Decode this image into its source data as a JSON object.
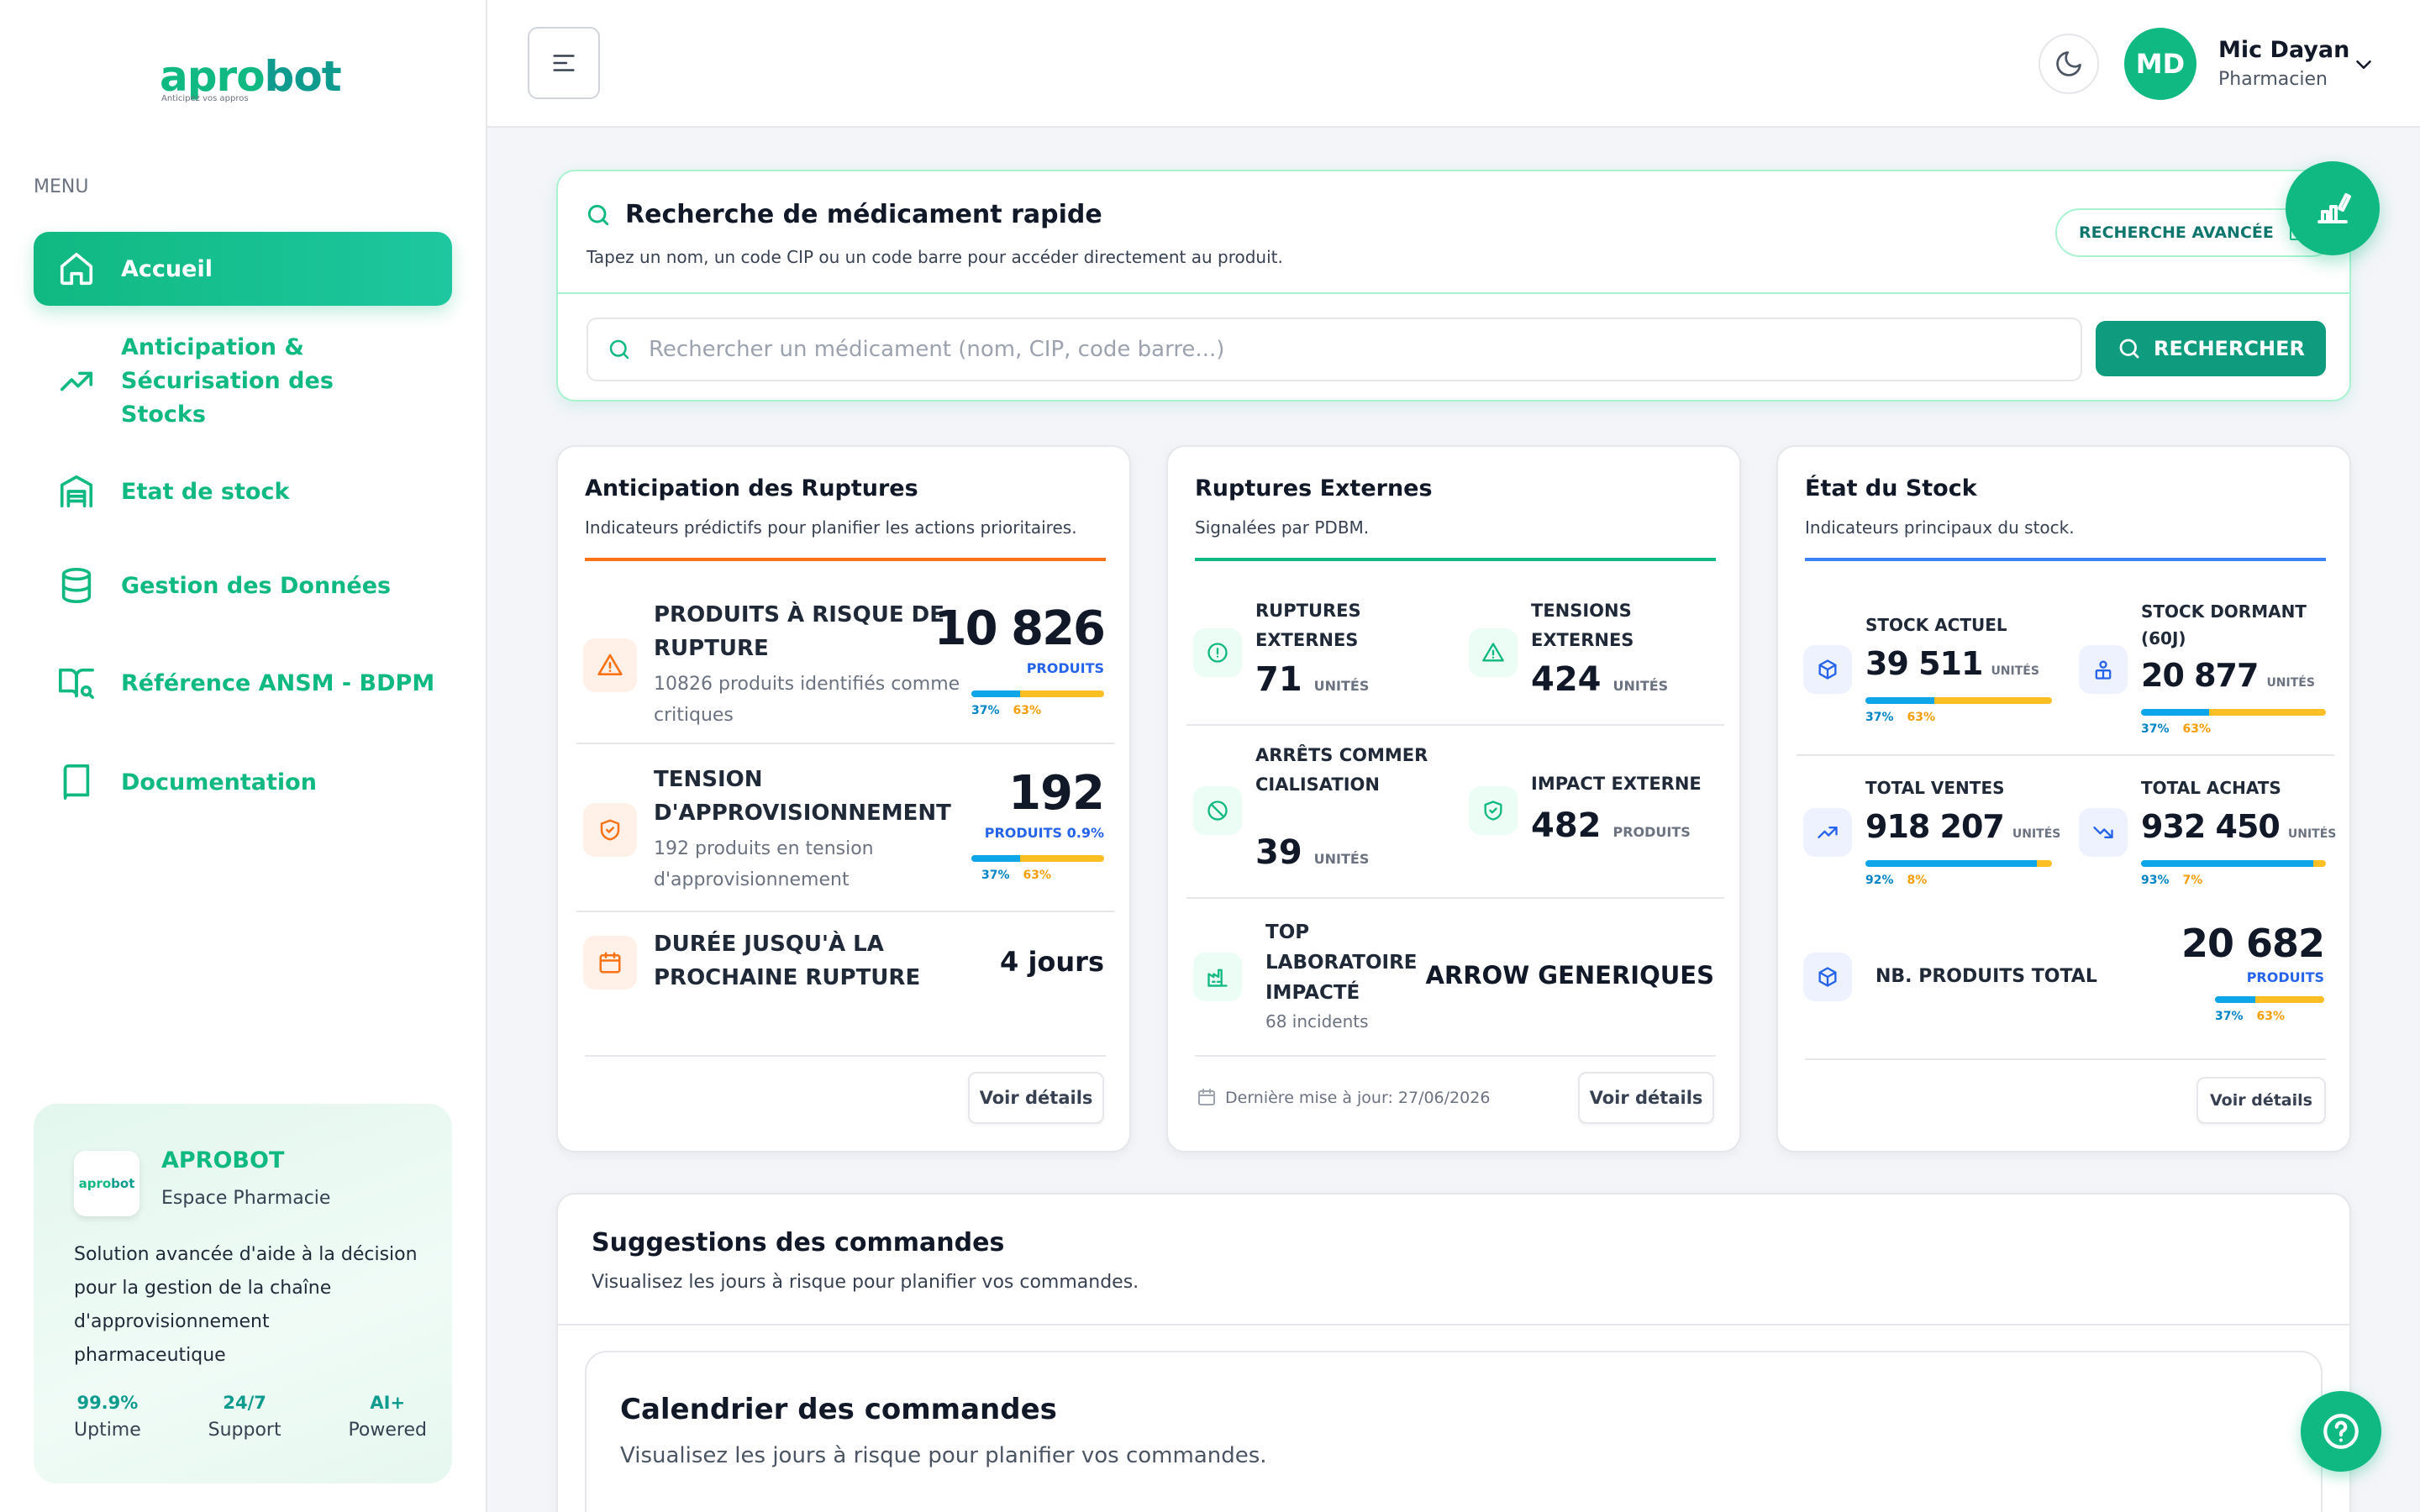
{
  "brand": {
    "logo_prefix": "apro",
    "logo_suffix": "bot",
    "tagline": "Anticipez vos appros"
  },
  "sidebar": {
    "menu_heading": "MENU",
    "items": [
      {
        "label": "Accueil",
        "icon": "home-icon"
      },
      {
        "label": "Anticipation & Sécurisation des Stocks",
        "icon": "trending-up-icon"
      },
      {
        "label": "Etat de stock",
        "icon": "warehouse-icon"
      },
      {
        "label": "Gestion des Données",
        "icon": "database-icon"
      },
      {
        "label": "Référence ANSM - BDPM",
        "icon": "book-search-icon"
      },
      {
        "label": "Documentation",
        "icon": "book-icon"
      }
    ],
    "promo": {
      "title": "APROBOT",
      "subtitle": "Espace Pharmacie",
      "description": "Solution avancée d'aide à la décision pour la gestion de la chaîne d'approvisionnement pharmaceutique",
      "stats": [
        {
          "value": "99.9%",
          "label": "Uptime"
        },
        {
          "value": "24/7",
          "label": "Support"
        },
        {
          "value": "AI+",
          "label": "Powered"
        }
      ]
    }
  },
  "header": {
    "user": {
      "initials": "MD",
      "name": "Mic Dayan",
      "role": "Pharmacien"
    }
  },
  "search": {
    "title": "Recherche de médicament rapide",
    "description": "Tapez un nom, un code CIP ou un code barre pour accéder directement au produit.",
    "advanced_label": "RECHERCHE AVANCÉE",
    "placeholder": "Rechercher un médicament (nom, CIP, code barre...)",
    "button_label": "RECHERCHER"
  },
  "cards": {
    "ruptures": {
      "title": "Anticipation des Ruptures",
      "subtitle": "Indicateurs prédictifs pour planifier les actions prioritaires.",
      "rows": [
        {
          "label": "PRODUITS À RISQUE DE RUPTURE",
          "desc": "10826 produits identifiés comme critiques",
          "value": "10 826",
          "unit": "PRODUITS",
          "p1": "37%",
          "p2": "63%",
          "share": 0.37
        },
        {
          "label": "TENSION D'APPROVISIONNEMENT",
          "desc": "192 produits en tension d'approvisionnement",
          "value": "192",
          "unit": "PRODUITS 0.9%",
          "p1": "37%",
          "p2": "63%",
          "share": 0.37
        },
        {
          "label": "DURÉE JUSQU'À LA PROCHAINE RUPTURE",
          "value": "4 jours"
        }
      ],
      "details_label": "Voir détails"
    },
    "externes": {
      "title": "Ruptures Externes",
      "subtitle": "Signalées par PDBM.",
      "ruptures": {
        "label": "RUPTURES EXTERNES",
        "value": "71",
        "unit": "UNITÉS"
      },
      "tensions": {
        "label": "TENSIONS EXTERNES",
        "value": "424",
        "unit": "UNITÉS"
      },
      "arrets": {
        "label": "ARRÊTS COMMERCIALISATION",
        "value": "39",
        "unit": "UNITÉS"
      },
      "impact": {
        "label": "IMPACT EXTERNE",
        "value": "482",
        "unit": "PRODUITS"
      },
      "top_lab": {
        "label": "TOP LABORATOIRE IMPACTÉ",
        "sub": "68 incidents",
        "value": "ARROW GENERIQUES"
      },
      "updated": "Dernière mise à jour: 27/06/2026",
      "details_label": "Voir détails"
    },
    "stock": {
      "title": "État du Stock",
      "subtitle": "Indicateurs principaux du stock.",
      "stock_actuel": {
        "label": "STOCK ACTUEL",
        "value": "39 511",
        "unit": "UNITÉS",
        "p1": "37%",
        "p2": "63%",
        "share": 0.37
      },
      "stock_dormant": {
        "label": "STOCK DORMANT (60J)",
        "value": "20 877",
        "unit": "UNITÉS",
        "p1": "37%",
        "p2": "63%",
        "share": 0.37
      },
      "total_ventes": {
        "label": "TOTAL VENTES",
        "value": "918 207",
        "unit": "UNITÉS",
        "p1": "92%",
        "p2": "8%",
        "share": 0.92
      },
      "total_achats": {
        "label": "TOTAL ACHATS",
        "value": "932 450",
        "unit": "UNITÉS",
        "p1": "93%",
        "p2": "7%",
        "share": 0.93
      },
      "nb_produits": {
        "label": "NB. PRODUITS TOTAL",
        "value": "20 682",
        "unit": "PRODUITS",
        "p1": "37%",
        "p2": "63%",
        "share": 0.37
      },
      "details_label": "Voir détails"
    }
  },
  "suggestions": {
    "title": "Suggestions des commandes",
    "subtitle": "Visualisez les jours à risque pour planifier vos commandes.",
    "calendar": {
      "title": "Calendrier des commandes",
      "subtitle": "Visualisez les jours à risque pour planifier vos commandes."
    }
  },
  "colors": {
    "primary": "#10b981",
    "dark_green": "#0f9b8e",
    "orange": "#f97316",
    "blue": "#3b82f6",
    "sky": "#0ea5e9",
    "amber": "#fbbf24"
  }
}
